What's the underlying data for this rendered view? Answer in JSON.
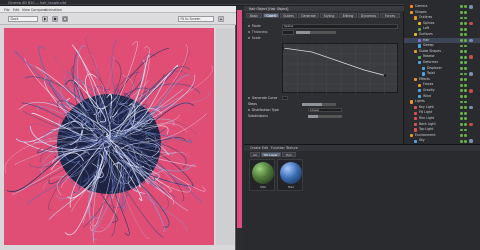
{
  "window": {
    "title": "Cinema 4D R20 — hair_tangle.c4d"
  },
  "viewer": {
    "menu": [
      "File",
      "Edit",
      "View",
      "Compare",
      "Animation"
    ],
    "zoom_field": "Dock",
    "view_field": "Fit to Screen"
  },
  "attributes": {
    "header": "Hair Object [Hair Object]",
    "tabs": [
      "Basic",
      "Coord",
      "Guides",
      "Generate",
      "Styling",
      "Editing",
      "Dynamics",
      "Forces"
    ],
    "active_tab": "Coord",
    "rows": [
      {
        "label": "Mode",
        "value": "Spline"
      },
      {
        "label": "Thickness",
        "value": ""
      },
      {
        "label": "Scale",
        "value": ""
      }
    ],
    "sections": [
      {
        "label": "Generate Curve",
        "value": ""
      },
      {
        "label": "Steps",
        "value": ""
      },
      {
        "label": "Distribution Type",
        "value": "Linear"
      },
      {
        "label": "Subdivisions",
        "value": ""
      }
    ],
    "graph_curve": [
      [
        0,
        0.92
      ],
      [
        0.25,
        0.84
      ],
      [
        0.5,
        0.64
      ],
      [
        0.7,
        0.48
      ],
      [
        0.88,
        0.37
      ]
    ]
  },
  "objects": [
    {
      "name": "Camera",
      "icon": "camera-icon",
      "color": "#ff8a00"
    },
    {
      "name": "Shapes",
      "icon": "null-icon",
      "color": "#e39a2a"
    },
    {
      "name": "Outlines",
      "icon": "null-icon",
      "color": "#e39a2a"
    },
    {
      "name": "Splines",
      "icon": "spline-icon",
      "color": "#e3b82a"
    },
    {
      "name": "Loft",
      "icon": "loft-icon",
      "color": "#5aa65a"
    },
    {
      "name": "Surfaces",
      "icon": "null-icon",
      "color": "#e3b82a"
    },
    {
      "name": "Hair",
      "icon": "hair-icon",
      "color": "#8e6fd9"
    },
    {
      "name": "Sweep",
      "icon": "sweep-icon",
      "color": "#4aa6e8"
    },
    {
      "name": "Guide Shapes",
      "icon": "null-icon",
      "color": "#e39a2a"
    },
    {
      "name": "Rotator",
      "icon": "rotator-icon",
      "color": "#5aa65a"
    },
    {
      "name": "Deformer",
      "icon": "deformer-icon",
      "color": "#4aa6e8"
    },
    {
      "name": "Displacer",
      "icon": "displacer-icon",
      "color": "#4aa6e8"
    },
    {
      "name": "Twist",
      "icon": "twist-icon",
      "color": "#4aa6e8"
    },
    {
      "name": "Effects",
      "icon": "null-icon",
      "color": "#e39a2a"
    },
    {
      "name": "Forces",
      "icon": "null-icon",
      "color": "#e39a2a"
    },
    {
      "name": "Gravity",
      "icon": "gravity-icon",
      "color": "#4aa6e8"
    },
    {
      "name": "Wind",
      "icon": "wind-icon",
      "color": "#4aa6e8"
    },
    {
      "name": "Lights",
      "icon": "null-icon",
      "color": "#e39a2a"
    },
    {
      "name": "Key Light",
      "icon": "light-icon",
      "color": "#e05050"
    },
    {
      "name": "Fill Light",
      "icon": "light-icon",
      "color": "#e05050"
    },
    {
      "name": "Rim Light",
      "icon": "light-icon",
      "color": "#e05050"
    },
    {
      "name": "Back Light",
      "icon": "light-icon",
      "color": "#e05050"
    },
    {
      "name": "Top Light",
      "icon": "light-icon",
      "color": "#e05050"
    },
    {
      "name": "Environment",
      "icon": "null-icon",
      "color": "#e39a2a"
    },
    {
      "name": "Sky",
      "icon": "sky-icon",
      "color": "#4aa6e8"
    }
  ],
  "materials": {
    "menu": [
      "Create",
      "Edit",
      "Function",
      "Texture"
    ],
    "tabs": [
      "All",
      "No Layer",
      "Hair"
    ],
    "active_tab": "No Layer",
    "items": [
      {
        "name": "Mat",
        "color": "#4f7a3c"
      },
      {
        "name": "Hair",
        "color": "#3d6fb5"
      }
    ]
  }
}
